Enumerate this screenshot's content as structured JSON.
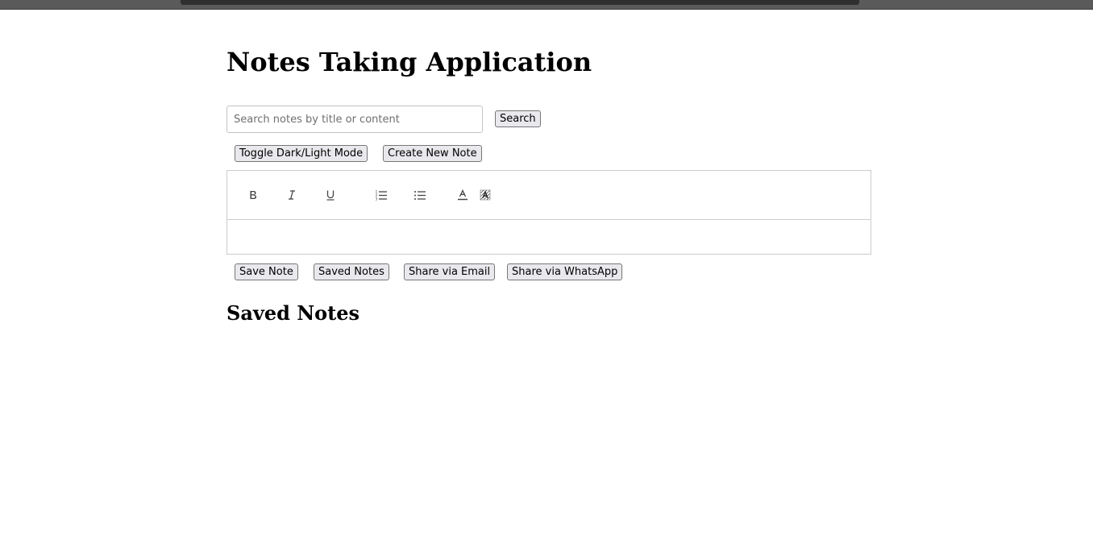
{
  "app": {
    "title": "Notes Taking Application"
  },
  "search": {
    "placeholder": "Search notes by title or content",
    "value": "",
    "button_label": "Search"
  },
  "actions": {
    "toggle_mode_label": "Toggle Dark/Light Mode",
    "create_note_label": "Create New Note"
  },
  "editor": {
    "toolbar": [
      {
        "name": "bold",
        "icon": "bold-icon"
      },
      {
        "name": "italic",
        "icon": "italic-icon"
      },
      {
        "name": "underline",
        "icon": "underline-icon"
      },
      {
        "name": "ordered-list",
        "icon": "ordered-list-icon"
      },
      {
        "name": "bullet-list",
        "icon": "bullet-list-icon"
      },
      {
        "name": "text-color",
        "icon": "text-color-icon"
      },
      {
        "name": "background-color",
        "icon": "background-color-icon"
      }
    ],
    "content": ""
  },
  "note_actions": {
    "save_label": "Save Note",
    "saved_notes_label": "Saved Notes",
    "share_email_label": "Share via Email",
    "share_whatsapp_label": "Share via WhatsApp"
  },
  "saved_section": {
    "heading": "Saved Notes",
    "notes": []
  }
}
